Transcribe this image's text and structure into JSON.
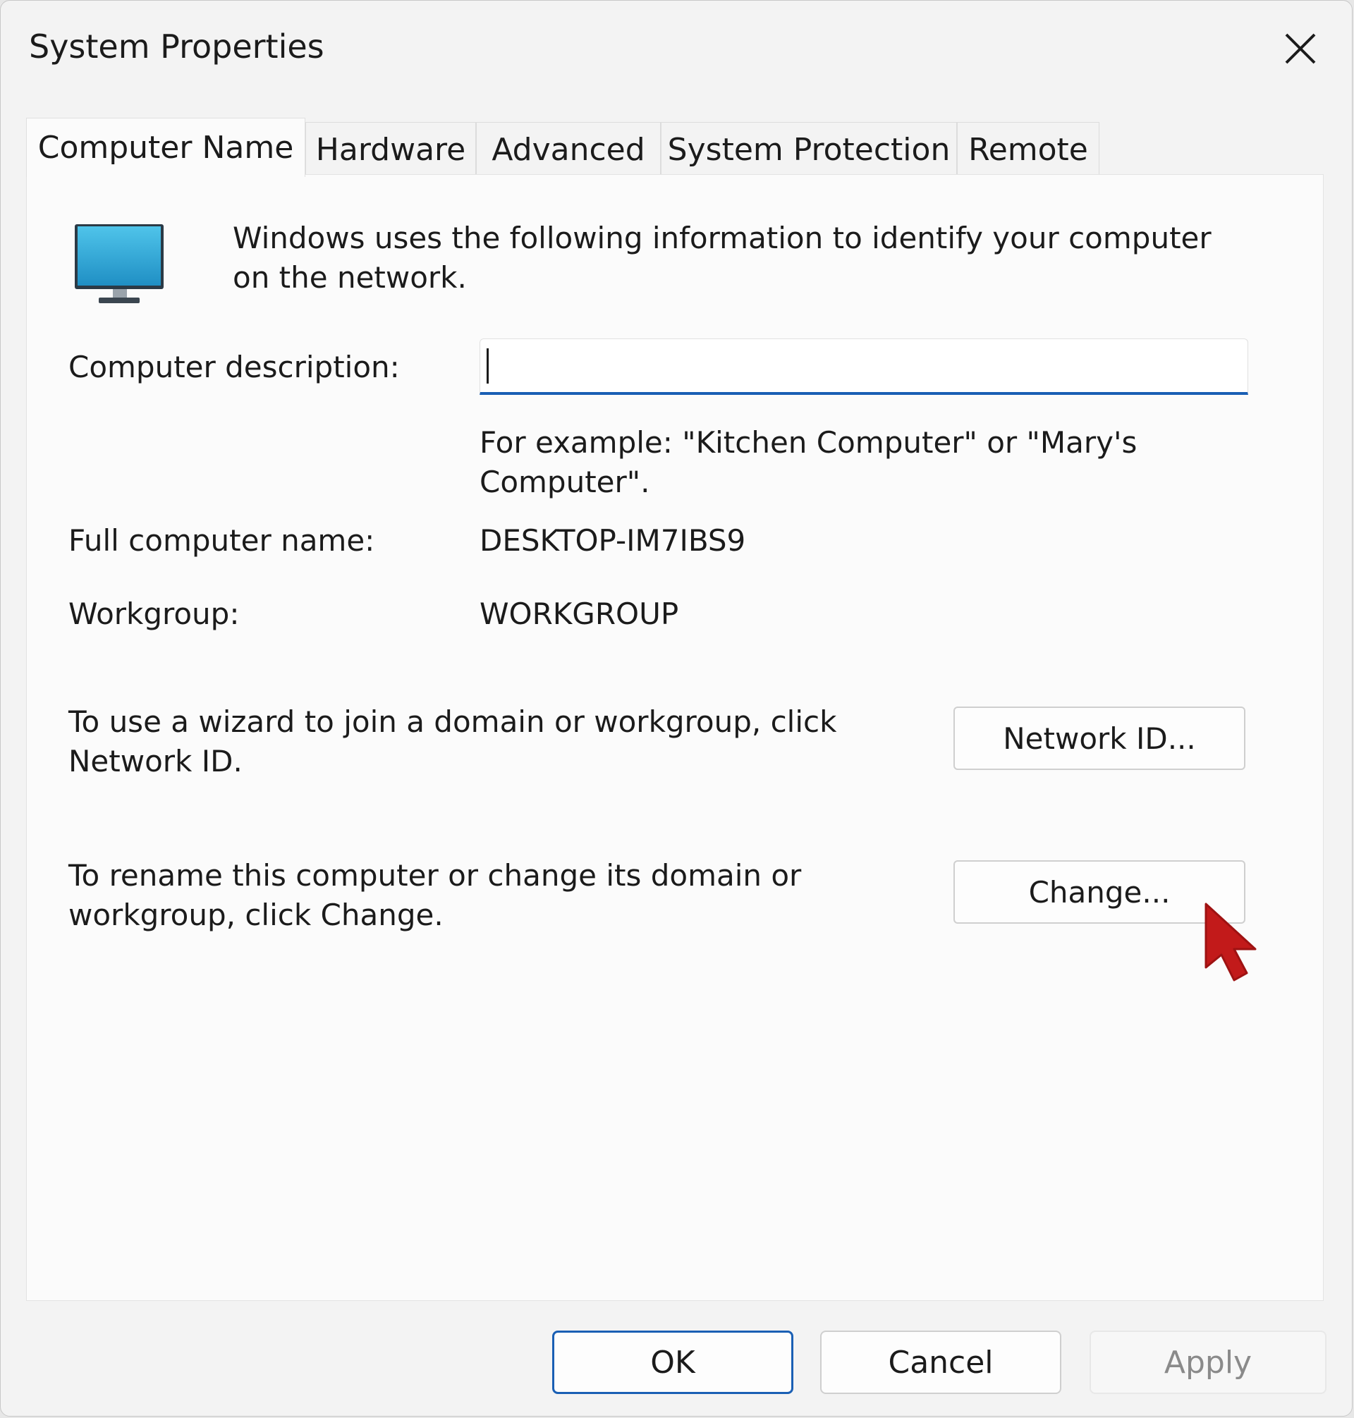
{
  "window": {
    "title": "System Properties",
    "close_icon": "close-icon"
  },
  "tabs": [
    {
      "label": "Computer Name",
      "active": true
    },
    {
      "label": "Hardware",
      "active": false
    },
    {
      "label": "Advanced",
      "active": false
    },
    {
      "label": "System Protection",
      "active": false
    },
    {
      "label": "Remote",
      "active": false
    }
  ],
  "computer_name_tab": {
    "icon": "monitor-icon",
    "intro_text": "Windows uses the following information to identify your computer on the network.",
    "description_label": "Computer description:",
    "description_value": "",
    "description_example": "For example: \"Kitchen Computer\" or \"Mary's Computer\".",
    "full_name_label": "Full computer name:",
    "full_name_value": "DESKTOP-IM7IBS9",
    "workgroup_label": "Workgroup:",
    "workgroup_value": "WORKGROUP",
    "network_id_text": "To use a wizard to join a domain or workgroup, click Network ID.",
    "network_id_button": "Network ID...",
    "change_text": "To rename this computer or change its domain or workgroup, click Change.",
    "change_button": "Change...",
    "pointer_icon": "mouse-pointer-icon"
  },
  "footer": {
    "ok": "OK",
    "cancel": "Cancel",
    "apply": "Apply"
  },
  "colors": {
    "accent": "#1a5fb4",
    "pointer": "#c21a1a",
    "monitor_screen": "#2aa6d6"
  }
}
